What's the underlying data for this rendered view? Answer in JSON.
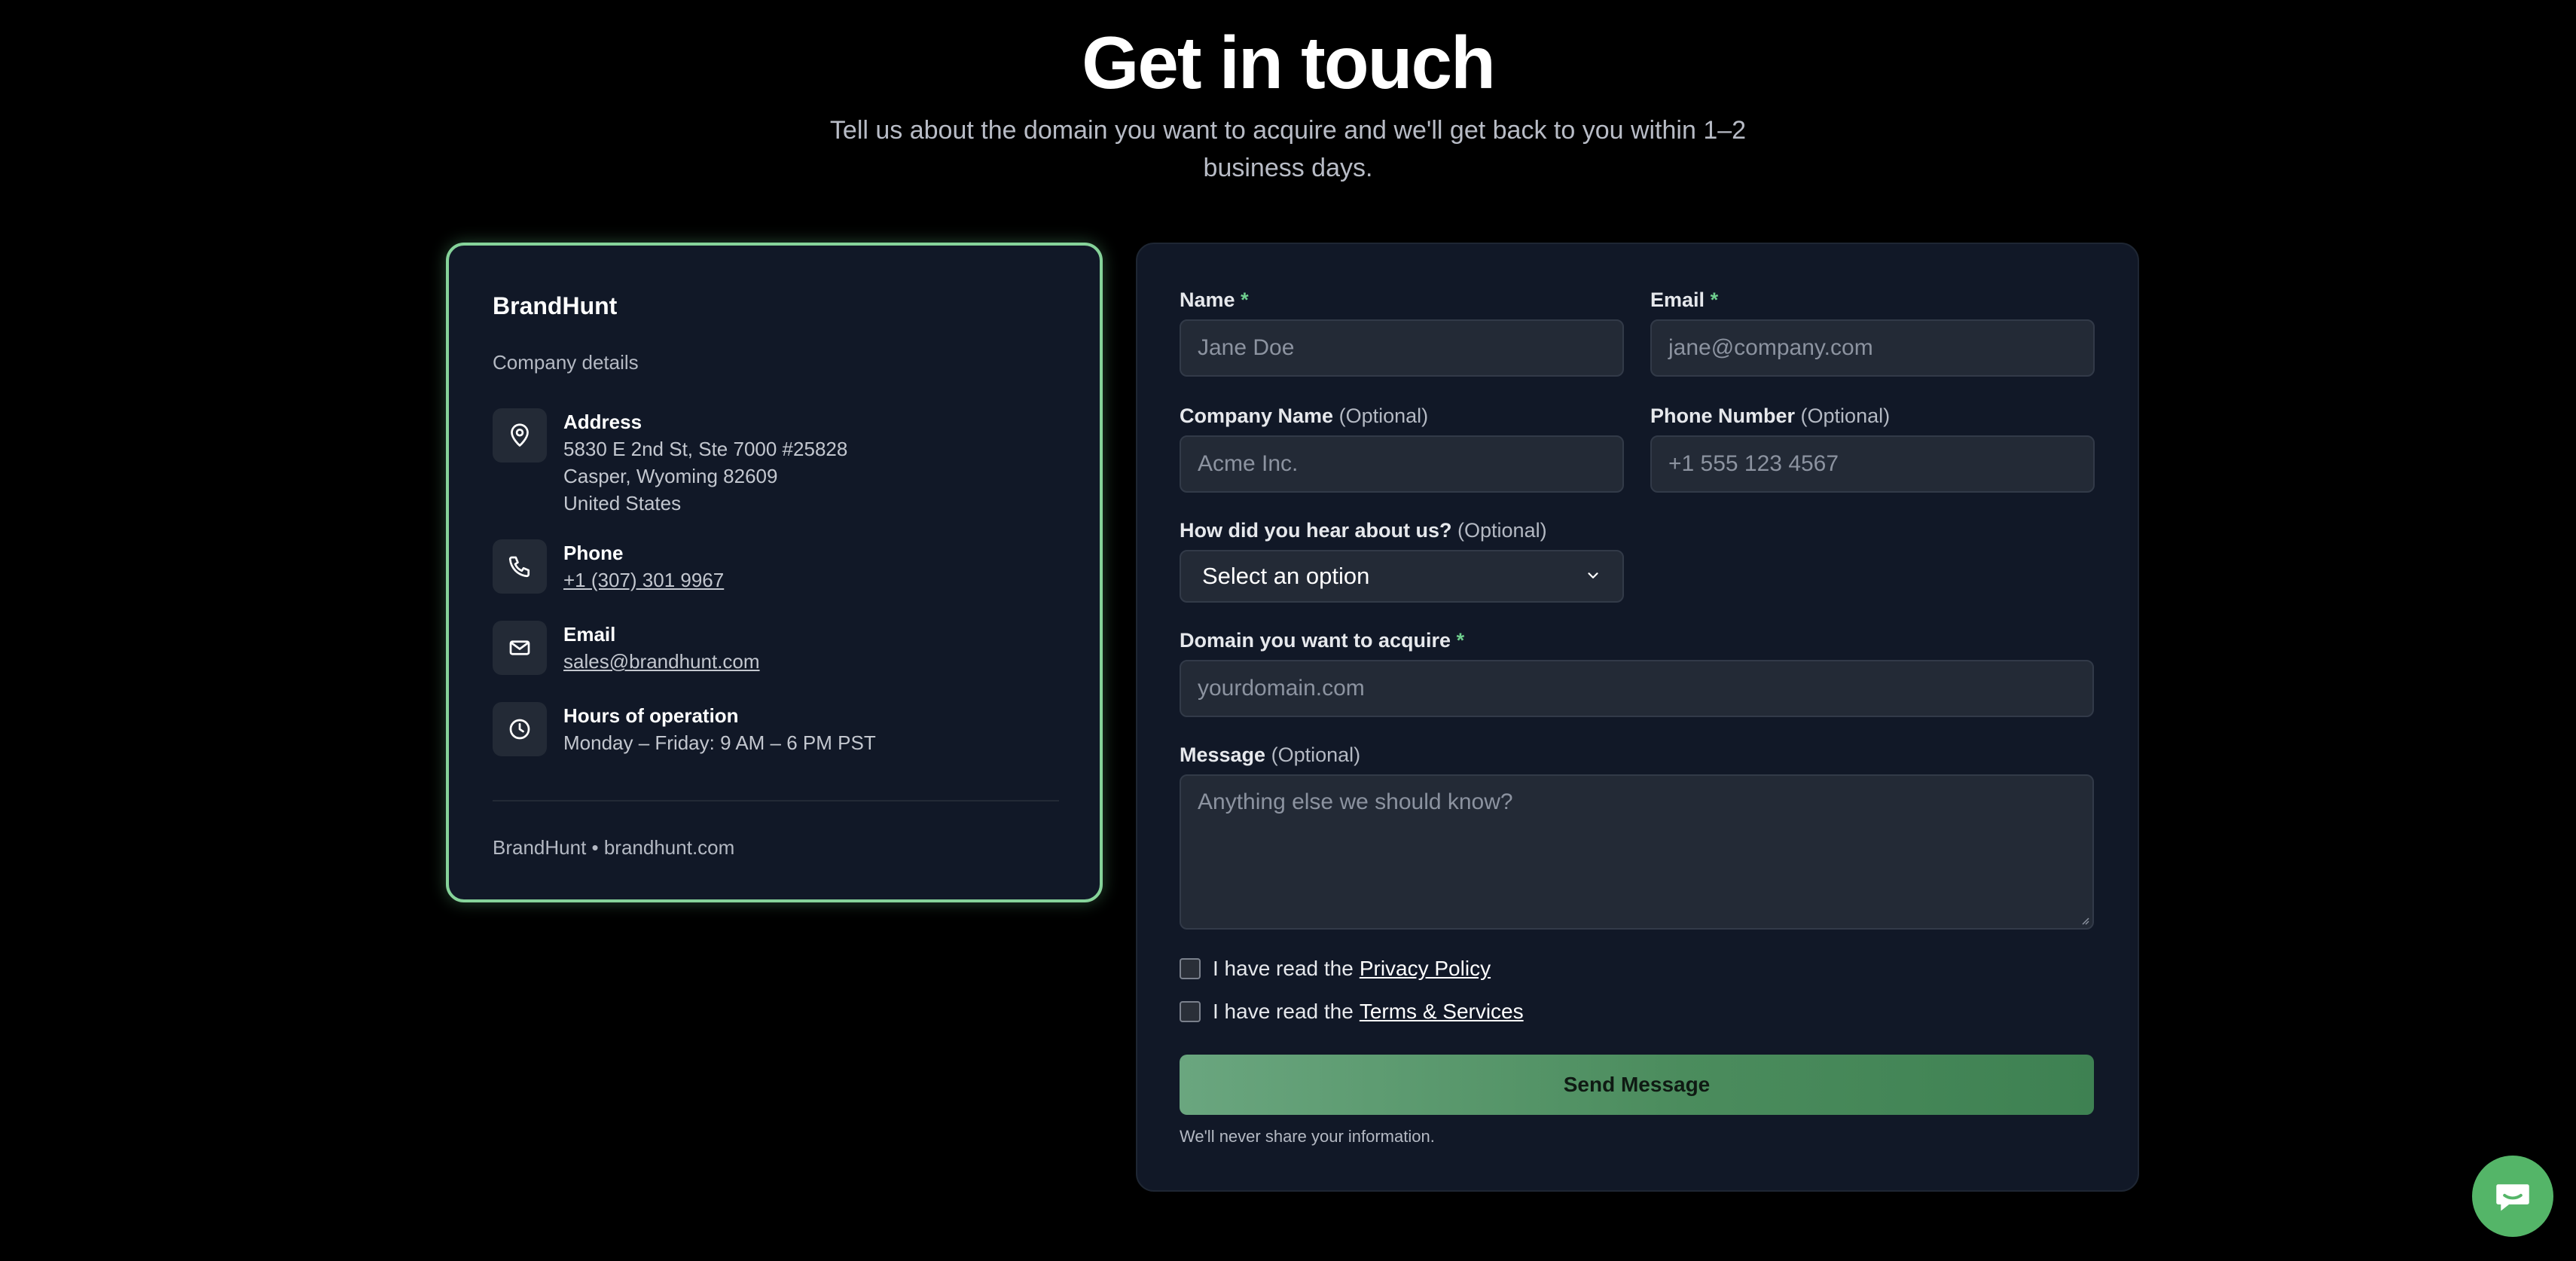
{
  "hero": {
    "title": "Get in touch",
    "subtitle": "Tell us about the domain you want to acquire and we'll get back to you within 1–2 business days."
  },
  "company": {
    "name": "BrandHunt",
    "subtitle": "Company details",
    "address_label": "Address",
    "address_lines": [
      "5830 E 2nd St, Ste 7000 #25828",
      "Casper, Wyoming 82609",
      "United States"
    ],
    "phone_label": "Phone",
    "phone": "+1 (307) 301 9967",
    "email_label": "Email",
    "email": "sales@brandhunt.com",
    "hours_label": "Hours of operation",
    "hours": "Monday – Friday: 9 AM – 6 PM PST",
    "footer": "BrandHunt • brandhunt.com",
    "icons": [
      "map-pin-icon",
      "phone-icon",
      "mail-icon",
      "clock-icon"
    ],
    "accent_border": "#86d39a"
  },
  "form": {
    "name": {
      "label": "Name",
      "required_mark": "*",
      "placeholder": "Jane Doe"
    },
    "email": {
      "label": "Email",
      "required_mark": "*",
      "placeholder": "jane@company.com"
    },
    "company": {
      "label": "Company Name",
      "optional": "(Optional)",
      "placeholder": "Acme Inc."
    },
    "phone": {
      "label": "Phone Number",
      "optional": "(Optional)",
      "placeholder": "+1 555 123 4567"
    },
    "source": {
      "label": "How did you hear about us?",
      "optional": "(Optional)",
      "selected": "Select an option"
    },
    "domain": {
      "label": "Domain you want to acquire",
      "required_mark": "*",
      "placeholder": "yourdomain.com"
    },
    "message": {
      "label": "Message",
      "optional": "(Optional)",
      "placeholder": "Anything else we should know?"
    },
    "privacy_check": {
      "text": "I have read the",
      "link": "Privacy Policy",
      "checked": false
    },
    "terms_check": {
      "text": "I have read the",
      "link": "Terms & Services",
      "checked": false
    },
    "submit_label": "Send Message",
    "note": "We'll never share your information.",
    "required_color": "#6fcf8e",
    "button_gradient": [
      "#6aa67f",
      "#3e8152"
    ]
  },
  "chat": {
    "icon": "chat-bubble-icon",
    "color": "#54b568"
  }
}
